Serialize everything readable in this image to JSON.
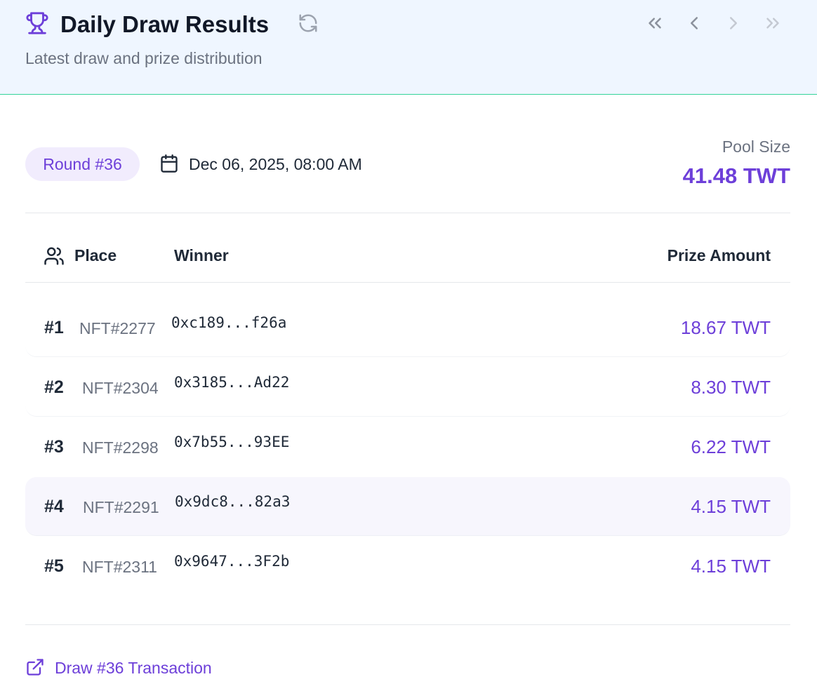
{
  "header": {
    "title": "Daily Draw Results",
    "subtitle": "Latest draw and prize distribution",
    "icons": {
      "title_icon": "trophy-icon",
      "refresh": "refresh-icon",
      "nav": [
        "chevrons-left-icon",
        "chevron-left-icon",
        "chevron-right-icon",
        "chevrons-right-icon"
      ]
    }
  },
  "round": {
    "badge": "Round #36",
    "date": "Dec 06, 2025, 08:00 AM",
    "date_icon": "calendar-icon"
  },
  "pool": {
    "label": "Pool Size",
    "value": "41.48 TWT"
  },
  "table": {
    "header_icon": "users-icon",
    "columns": {
      "place": "Place",
      "winner": "Winner",
      "prize": "Prize Amount"
    },
    "rows": [
      {
        "rank": "#1",
        "nft": "NFT#2277",
        "address": "0xc189...f26a",
        "prize": "18.67 TWT"
      },
      {
        "rank": "#2",
        "nft": "NFT#2304",
        "address": "0x3185...Ad22",
        "prize": "8.30 TWT"
      },
      {
        "rank": "#3",
        "nft": "NFT#2298",
        "address": "0x7b55...93EE",
        "prize": "6.22 TWT"
      },
      {
        "rank": "#4",
        "nft": "NFT#2291",
        "address": "0x9dc8...82a3",
        "prize": "4.15 TWT"
      },
      {
        "rank": "#5",
        "nft": "NFT#2311",
        "address": "0x9647...3F2b",
        "prize": "4.15 TWT"
      }
    ]
  },
  "footer": {
    "link_label": "Draw #36 Transaction",
    "link_icon": "external-link-icon"
  },
  "colors": {
    "accent": "#6d3fd9",
    "header_bg": "#eff6ff",
    "header_border": "#34d399",
    "badge_bg": "#f1ecfd",
    "muted_text": "#6b7280",
    "nav_inactive": "#c4c9d2"
  }
}
